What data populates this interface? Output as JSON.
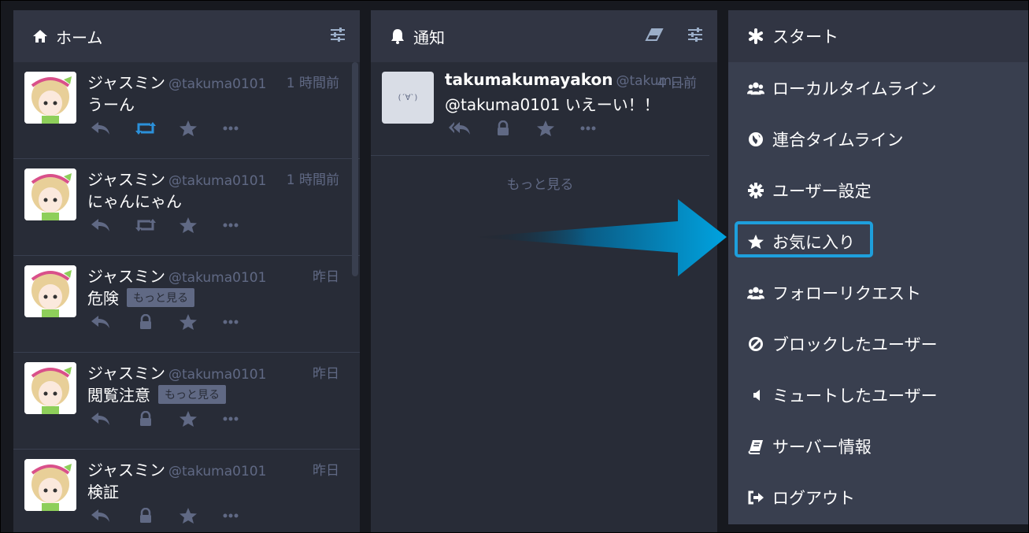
{
  "home": {
    "title": "ホーム",
    "statuses": [
      {
        "name": "ジャスミン",
        "handle": "@takuma0101",
        "time": "1 時間前",
        "text": "うーん",
        "more": "",
        "boost_active": true
      },
      {
        "name": "ジャスミン",
        "handle": "@takuma0101",
        "time": "1 時間前",
        "text": "にゃんにゃん",
        "more": "",
        "boost_active": false
      },
      {
        "name": "ジャスミン",
        "handle": "@takuma0101",
        "time": "昨日",
        "text": "危険",
        "more": "もっと見る",
        "locked": true
      },
      {
        "name": "ジャスミン",
        "handle": "@takuma0101",
        "time": "昨日",
        "text": "閲覧注意",
        "more": "もっと見る",
        "locked": true
      },
      {
        "name": "ジャスミン",
        "handle": "@takuma0101",
        "time": "昨日",
        "text": "検証",
        "more": "",
        "locked": true
      }
    ]
  },
  "notifications": {
    "title": "通知",
    "status": {
      "name": "takumakumayakon",
      "handle": "@takum...",
      "time": "4 日前",
      "text": "@takuma0101 いえーい！！",
      "avatar_text": "(´∀`)"
    },
    "load_more": "もっと見る"
  },
  "menu": {
    "items": [
      {
        "label": "スタート",
        "icon": "asterisk-icon"
      },
      {
        "label": "ローカルタイムライン",
        "icon": "users-icon"
      },
      {
        "label": "連合タイムライン",
        "icon": "globe-icon"
      },
      {
        "label": "ユーザー設定",
        "icon": "cog-icon"
      },
      {
        "label": "お気に入り",
        "icon": "star-icon"
      },
      {
        "label": "フォローリクエスト",
        "icon": "users-icon"
      },
      {
        "label": "ブロックしたユーザー",
        "icon": "ban-icon"
      },
      {
        "label": "ミュートしたユーザー",
        "icon": "volume-off-icon"
      },
      {
        "label": "サーバー情報",
        "icon": "book-icon"
      },
      {
        "label": "ログアウト",
        "icon": "sign-out-icon"
      }
    ]
  },
  "colors": {
    "accent": "#1e9fdc",
    "column_bg": "#282c37",
    "header_bg": "#313543",
    "menu_bg": "#393f4f",
    "muted": "#606984"
  }
}
